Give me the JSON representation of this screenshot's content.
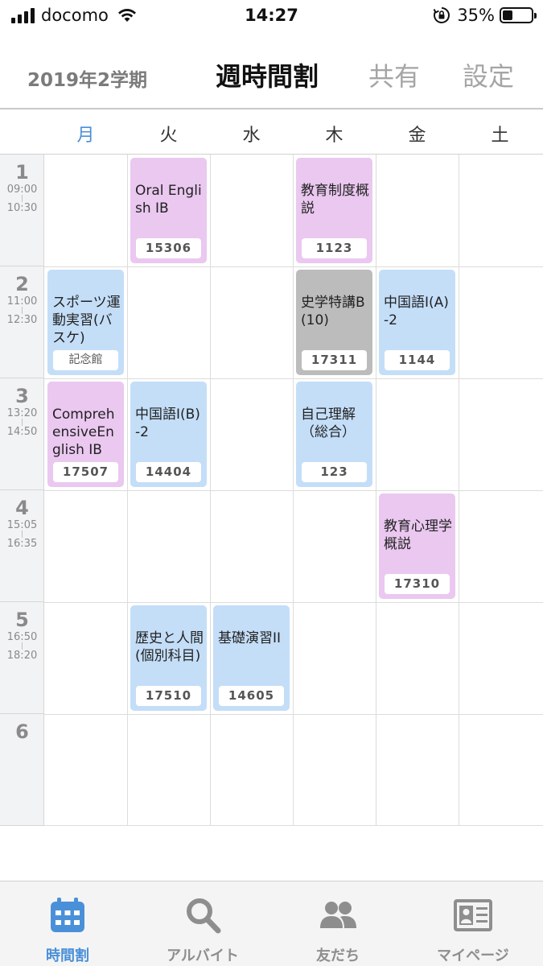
{
  "status_bar": {
    "carrier": "docomo",
    "time": "14:27",
    "battery": "35%",
    "battery_level": 0.35
  },
  "header": {
    "term": "2019年2学期",
    "title": "週時間割",
    "share": "共有",
    "settings": "設定"
  },
  "days": [
    "月",
    "火",
    "水",
    "木",
    "金",
    "土"
  ],
  "active_day": "月",
  "periods": [
    {
      "num": "1",
      "start": "09:00",
      "end": "10:30"
    },
    {
      "num": "2",
      "start": "11:00",
      "end": "12:30"
    },
    {
      "num": "3",
      "start": "13:20",
      "end": "14:50"
    },
    {
      "num": "4",
      "start": "15:05",
      "end": "16:35"
    },
    {
      "num": "5",
      "start": "16:50",
      "end": "18:20"
    },
    {
      "num": "6",
      "start": "",
      "end": ""
    }
  ],
  "classes": [
    {
      "day": 1,
      "period": 0,
      "name": "Oral English IB",
      "room": "15306",
      "color": "pink"
    },
    {
      "day": 3,
      "period": 0,
      "name": "教育制度概説",
      "room": "1123",
      "color": "pink"
    },
    {
      "day": 0,
      "period": 1,
      "name": "スポーツ運動実習(バスケ)",
      "room": "記念館",
      "color": "blue"
    },
    {
      "day": 3,
      "period": 1,
      "name": "史学特講B(10)",
      "room": "17311",
      "color": "gray"
    },
    {
      "day": 4,
      "period": 1,
      "name": "中国語I(A)-2",
      "room": "1144",
      "color": "blue"
    },
    {
      "day": 0,
      "period": 2,
      "name": "ComprehensiveEnglish IB",
      "room": "17507",
      "color": "pink"
    },
    {
      "day": 1,
      "period": 2,
      "name": "中国語I(B)-2",
      "room": "14404",
      "color": "blue"
    },
    {
      "day": 3,
      "period": 2,
      "name": "自己理解（総合）",
      "room": "123",
      "color": "blue"
    },
    {
      "day": 4,
      "period": 3,
      "name": "教育心理学概説",
      "room": "17310",
      "color": "pink"
    },
    {
      "day": 1,
      "period": 4,
      "name": "歴史と人間(個別科目)",
      "room": "17510",
      "color": "blue"
    },
    {
      "day": 2,
      "period": 4,
      "name": "基礎演習II",
      "room": "14605",
      "color": "blue"
    }
  ],
  "tabs": [
    {
      "label": "時間割",
      "icon": "calendar-icon",
      "active": true
    },
    {
      "label": "アルバイト",
      "icon": "search-icon",
      "active": false
    },
    {
      "label": "友だち",
      "icon": "friends-icon",
      "active": false
    },
    {
      "label": "マイページ",
      "icon": "id-card-icon",
      "active": false
    }
  ],
  "colors": {
    "accent": "#4a90d9",
    "pink": "#eac8f0",
    "blue": "#c4def8",
    "gray": "#bcbcbc"
  }
}
